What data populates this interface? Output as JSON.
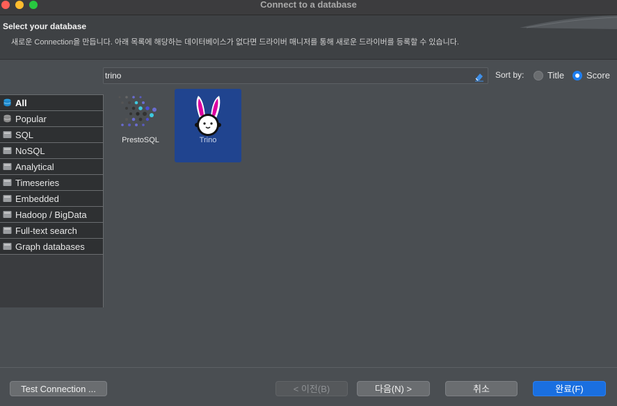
{
  "window": {
    "title": "Connect to a database"
  },
  "header": {
    "title": "Select your database",
    "description": "새로운 Connection을 만듭니다. 아래 목록에 해당하는 데이터베이스가 없다면 드라이버 매니저를 통해 새로운 드라이버를 등록할 수 있습니다."
  },
  "search": {
    "value": "trino"
  },
  "sort": {
    "label": "Sort by:",
    "options": [
      "Title",
      "Score"
    ],
    "selected": "Score"
  },
  "categories": [
    {
      "label": "All",
      "selected": true
    },
    {
      "label": "Popular"
    },
    {
      "label": "SQL"
    },
    {
      "label": "NoSQL"
    },
    {
      "label": "Analytical"
    },
    {
      "label": "Timeseries"
    },
    {
      "label": "Embedded"
    },
    {
      "label": "Hadoop / BigData"
    },
    {
      "label": "Full-text search"
    },
    {
      "label": "Graph databases"
    }
  ],
  "drivers": [
    {
      "name": "PrestoSQL",
      "selected": false,
      "icon": "prestosql-logo"
    },
    {
      "name": "Trino",
      "selected": true,
      "icon": "trino-bunny-logo"
    }
  ],
  "buttons": {
    "test": "Test Connection ...",
    "prev": "< 이전(B)",
    "next": "다음(N) >",
    "cancel": "취소",
    "finish": "완료(F)"
  },
  "colors": {
    "accent": "#1a6fe0",
    "selected_tile": "#20448f"
  }
}
